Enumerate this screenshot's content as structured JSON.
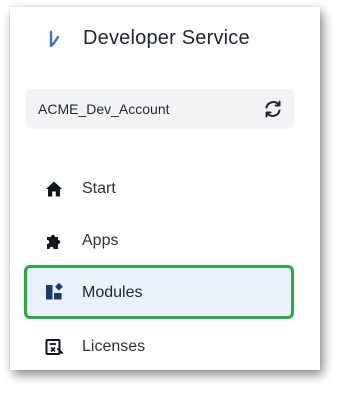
{
  "app": {
    "title": "Developer Service",
    "logo_icon": "brand-logo-icon",
    "brand_color": "#3a6fd8"
  },
  "account": {
    "name": "ACME_Dev_Account",
    "switch_icon": "sync-icon"
  },
  "nav": {
    "items": [
      {
        "label": "Start",
        "icon": "home-icon",
        "active": false
      },
      {
        "label": "Apps",
        "icon": "puzzle-icon",
        "active": false
      },
      {
        "label": "Modules",
        "icon": "modules-icon",
        "active": true
      },
      {
        "label": "Licenses",
        "icon": "license-icon",
        "active": false
      }
    ],
    "active_highlight_color": "#2ea84a",
    "active_background_color": "#e9f1fb"
  }
}
